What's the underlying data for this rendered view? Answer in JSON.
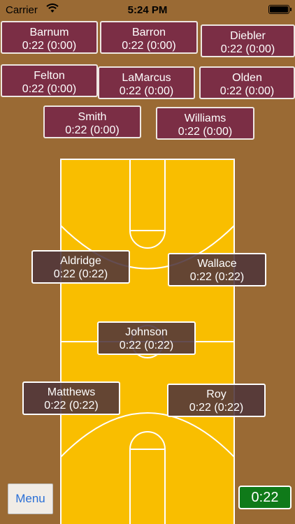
{
  "status_bar": {
    "carrier": "Carrier",
    "time": "5:24 PM"
  },
  "bench": [
    {
      "name": "Barnum",
      "time": "0:22 (0:00)"
    },
    {
      "name": "Barron",
      "time": "0:22 (0:00)"
    },
    {
      "name": "Diebler",
      "time": "0:22 (0:00)"
    },
    {
      "name": "Felton",
      "time": "0:22 (0:00)"
    },
    {
      "name": "LaMarcus",
      "time": "0:22 (0:00)"
    },
    {
      "name": "Olden",
      "time": "0:22 (0:00)"
    },
    {
      "name": "Smith",
      "time": "0:22 (0:00)"
    },
    {
      "name": "Williams",
      "time": "0:22 (0:00)"
    }
  ],
  "on_court": [
    {
      "name": "Aldridge",
      "time": "0:22 (0:22)"
    },
    {
      "name": "Wallace",
      "time": "0:22 (0:22)"
    },
    {
      "name": "Johnson",
      "time": "0:22 (0:22)"
    },
    {
      "name": "Matthews",
      "time": "0:22 (0:22)"
    },
    {
      "name": "Roy",
      "time": "0:22 (0:22)"
    }
  ],
  "menu_label": "Menu",
  "game_clock": "0:22"
}
